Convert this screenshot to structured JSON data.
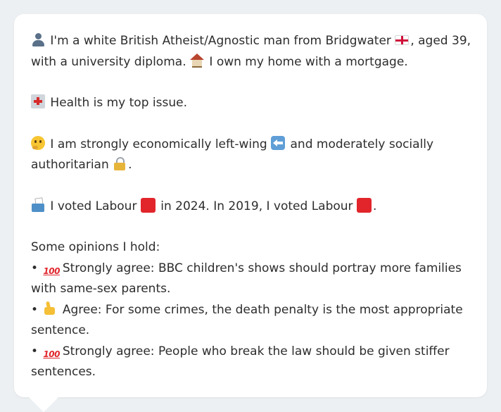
{
  "profile": {
    "intro": {
      "text_1": "I'm a white British Atheist/Agnostic man from Bridgwater",
      "text_2": ", aged 39, with a university diploma.",
      "text_3": "I own my home with a mortgage."
    },
    "health": {
      "text": "Health is my top issue."
    },
    "politics": {
      "text_1": "I am strongly economically left-wing",
      "text_2": "and moderately socially authoritarian",
      "text_3": "."
    },
    "voting": {
      "text_1": "I voted Labour",
      "text_2": "in 2024. In 2019, I voted Labour",
      "text_3": "."
    },
    "opinions": {
      "heading": "Some opinions I hold:",
      "bullet": "•",
      "items": [
        {
          "icon": "hundred-icon",
          "text": "Strongly agree: BBC children's shows should portray more families with same-sex parents."
        },
        {
          "icon": "thumbs-up-icon",
          "text": "Agree: For some crimes, the death penalty is the most appropriate sentence."
        },
        {
          "icon": "hundred-icon",
          "text": "Strongly agree: People who break the law should be given stiffer sentences."
        }
      ],
      "hundred_glyph": "100"
    }
  },
  "colors": {
    "background": "#edf0f3",
    "card": "#ffffff",
    "text": "#2d2d2d",
    "labour_red": "#e1252b"
  }
}
